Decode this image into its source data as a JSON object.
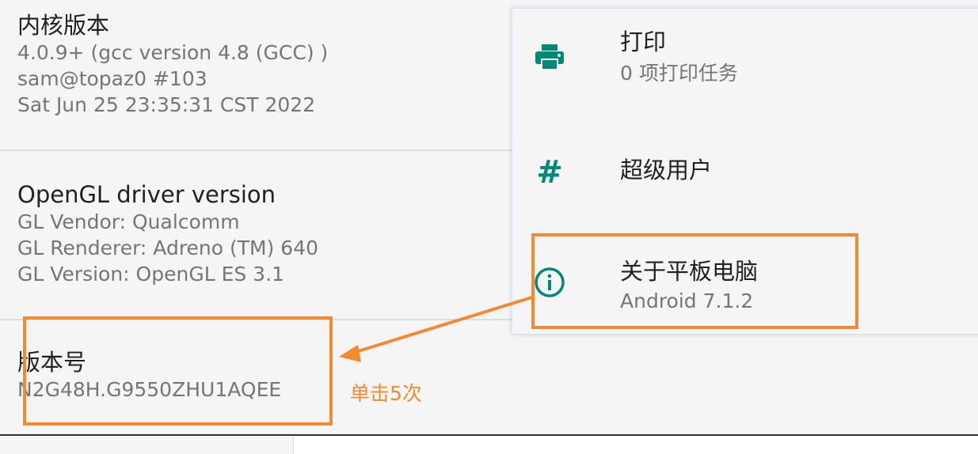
{
  "kernel": {
    "title": "内核版本",
    "lines": [
      "4.0.9+ (gcc version 4.8 (GCC) )",
      "sam@topaz0 #103",
      "Sat Jun 25 23:35:31 CST 2022"
    ]
  },
  "opengl": {
    "title": "OpenGL driver version",
    "lines": [
      "GL Vendor: Qualcomm",
      "GL Renderer: Adreno (TM) 640",
      "GL Version: OpenGL ES 3.1"
    ]
  },
  "build": {
    "title": "版本号",
    "value": "N2G48H.G9550ZHU1AQEE"
  },
  "panel": {
    "print": {
      "title": "打印",
      "subtitle": "0 项打印任务",
      "icon": "printer-icon"
    },
    "superuser": {
      "title": "超级用户",
      "icon": "hash-icon",
      "glyph": "#"
    },
    "about": {
      "title": "关于平板电脑",
      "subtitle": "Android 7.1.2",
      "icon": "info-icon"
    }
  },
  "annotation": {
    "instruction": "单击5次",
    "color": "#f28a30"
  },
  "colors": {
    "accent": "#00897b",
    "background": "#f5f5f5"
  }
}
